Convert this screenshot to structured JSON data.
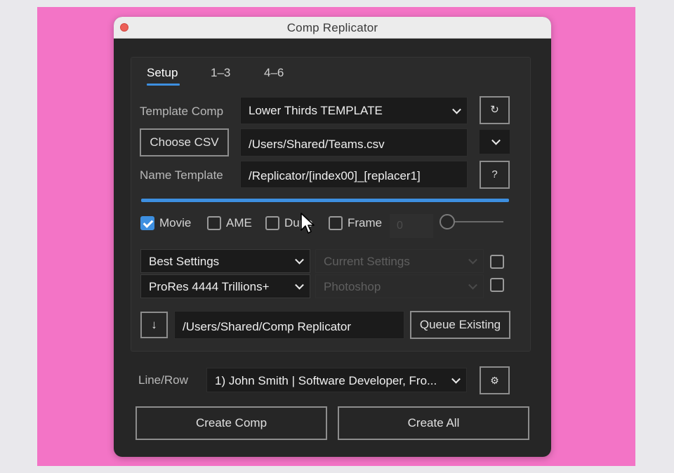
{
  "window": {
    "title": "Comp Replicator"
  },
  "tabs": [
    {
      "label": "Setup",
      "active": true
    },
    {
      "label": "1–3",
      "active": false
    },
    {
      "label": "4–6",
      "active": false
    }
  ],
  "template_comp": {
    "label": "Template Comp",
    "value": "Lower Thirds TEMPLATE",
    "refresh_icon": "↻"
  },
  "csv": {
    "button": "Choose CSV",
    "path": "/Users/Shared/Teams.csv"
  },
  "name_template": {
    "label": "Name Template",
    "value": "/Replicator/[index00]_[replacer1]",
    "help": "?"
  },
  "progress": {
    "value": 1.0,
    "color": "#3d8fe0"
  },
  "outputs": {
    "movie": {
      "label": "Movie",
      "checked": true
    },
    "ame": {
      "label": "AME",
      "checked": false
    },
    "dupe": {
      "label": "Dupe",
      "checked": false
    },
    "frame": {
      "label": "Frame",
      "checked": false
    },
    "frame_number": "0"
  },
  "render": {
    "render_settings": "Best Settings",
    "output_module": "ProRes 4444 Trillions+",
    "frame_render_settings": "Current Settings",
    "frame_output_module": "Photoshop"
  },
  "output_folder": {
    "download_icon": "↓",
    "path": "/Users/Shared/Comp Replicator",
    "queue_button": "Queue Existing"
  },
  "line_row": {
    "label": "Line/Row",
    "value": "1) John Smith | Software Developer, Fro...",
    "gear_icon": "⚙"
  },
  "actions": {
    "create_comp": "Create Comp",
    "create_all": "Create All"
  },
  "colors": {
    "accent": "#3d8fe0",
    "background": "#f374c6",
    "panel": "#262626"
  }
}
